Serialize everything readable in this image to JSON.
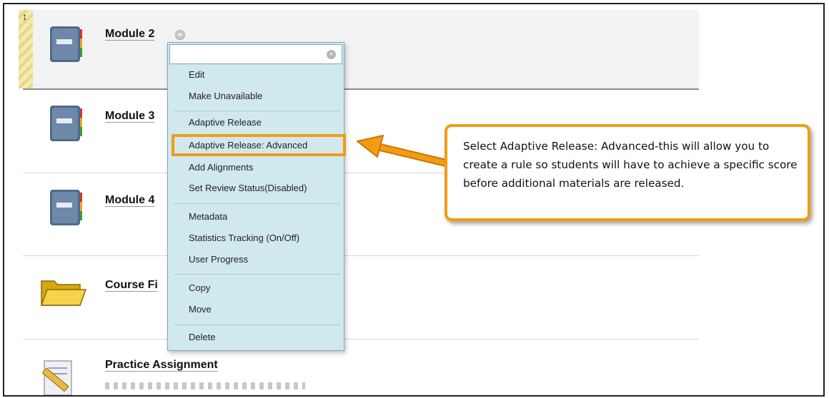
{
  "modules": [
    {
      "title": "Module 2",
      "icon": "notebook-icon"
    },
    {
      "title": "Module 3",
      "icon": "notebook-icon"
    },
    {
      "title": "Module 4",
      "icon": "notebook-icon"
    },
    {
      "title": "Course Fi",
      "icon": "folder-icon"
    },
    {
      "title": "Practice Assignment",
      "icon": "assignment-icon"
    }
  ],
  "menu": {
    "search_value": "",
    "items": [
      "Edit",
      "Make Unavailable",
      "Adaptive Release",
      "Adaptive Release: Advanced",
      "Add Alignments",
      "Set Review Status(Disabled)",
      "Metadata",
      "Statistics Tracking (On/Off)",
      "User Progress",
      "Copy",
      "Move",
      "Delete"
    ],
    "highlighted_item": "Adaptive Release: Advanced"
  },
  "callout": {
    "text": "Select Adaptive Release: Advanced-this will allow you to create a rule so students will have to achieve a specific score before additional materials are released."
  },
  "colors": {
    "highlight": "#f39c12",
    "menu_bg": "#d0e9ef",
    "selected_row_bg": "#f3f3f3"
  }
}
